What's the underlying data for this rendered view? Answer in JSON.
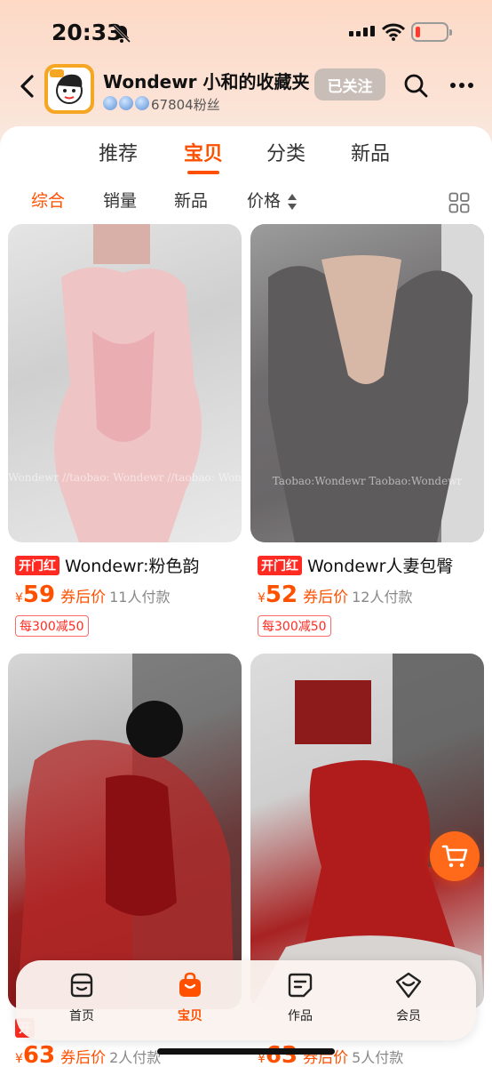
{
  "status_bar": {
    "time": "20:33",
    "battery_level": 0.15,
    "icons": [
      "bell-off-icon",
      "signal-icon",
      "wifi-icon",
      "battery-icon"
    ]
  },
  "shop": {
    "name": "Wondewr 小和的收藏夹",
    "fans": "67804粉丝",
    "follow_label": "已关注"
  },
  "tabs": [
    {
      "label": "推荐",
      "active": false
    },
    {
      "label": "宝贝",
      "active": true
    },
    {
      "label": "分类",
      "active": false
    },
    {
      "label": "新品",
      "active": false
    }
  ],
  "sort": {
    "items": [
      {
        "label": "综合",
        "active": true
      },
      {
        "label": "销量",
        "active": false
      },
      {
        "label": "新品",
        "active": false
      },
      {
        "label": "价格",
        "active": false
      }
    ]
  },
  "products": [
    {
      "tag": "开门红",
      "title": "Wondewr:粉色韵",
      "price_symbol": "¥",
      "price": "59",
      "price_label": "券后价",
      "sold": "11人付款",
      "coupon": "每300减50",
      "watermark": "Wondewr //taobao: Wondewr //taobao: Won"
    },
    {
      "tag": "开门红",
      "title": "Wondewr人妻包臀",
      "price_symbol": "¥",
      "price": "52",
      "price_label": "券后价",
      "sold": "12人付款",
      "coupon": "每300减50",
      "watermark": "Taobao:Wondewr   Taobao:Wondewr"
    },
    {
      "tag": "开",
      "title": "",
      "price_symbol": "¥",
      "price": "63",
      "price_label": "券后价",
      "sold": "2人付款",
      "coupon": ""
    },
    {
      "tag": "",
      "title": "",
      "price_symbol": "¥",
      "price": "63",
      "price_label": "券后价",
      "sold": "5人付款",
      "coupon": ""
    }
  ],
  "bottom_nav": [
    {
      "label": "首页",
      "icon": "shop-home-icon",
      "active": false
    },
    {
      "label": "宝贝",
      "icon": "bag-icon",
      "active": true
    },
    {
      "label": "作品",
      "icon": "works-icon",
      "active": false
    },
    {
      "label": "会员",
      "icon": "member-icon",
      "active": false
    }
  ],
  "colors": {
    "accent": "#ff5000",
    "promo_red": "#ff2b22"
  }
}
